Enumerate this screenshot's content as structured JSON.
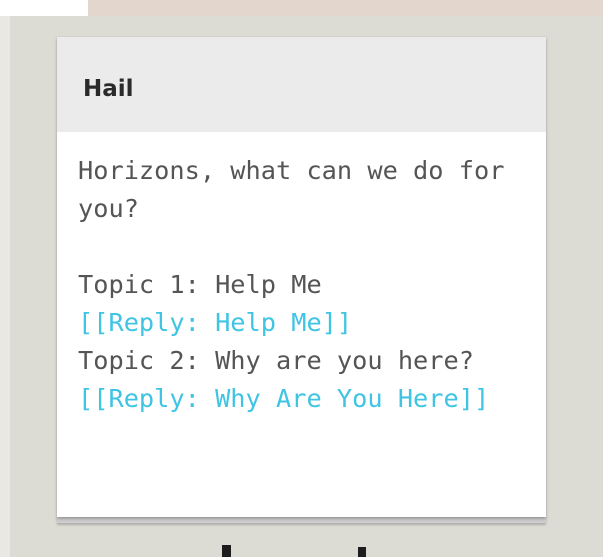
{
  "card": {
    "title": "Hail",
    "greeting": "Horizons, what can we do for you?",
    "topics": [
      {
        "text": "Topic 1: Help Me",
        "reply_link": "[[Reply: Help Me]]"
      },
      {
        "text": "Topic 2: Why are you here?",
        "reply_link": "[[Reply: Why Are You Here]]"
      }
    ]
  },
  "colors": {
    "background": "#dcdbd4",
    "header_bg": "#ebebeb",
    "body_text": "#555555",
    "link": "#3fc4e4"
  }
}
